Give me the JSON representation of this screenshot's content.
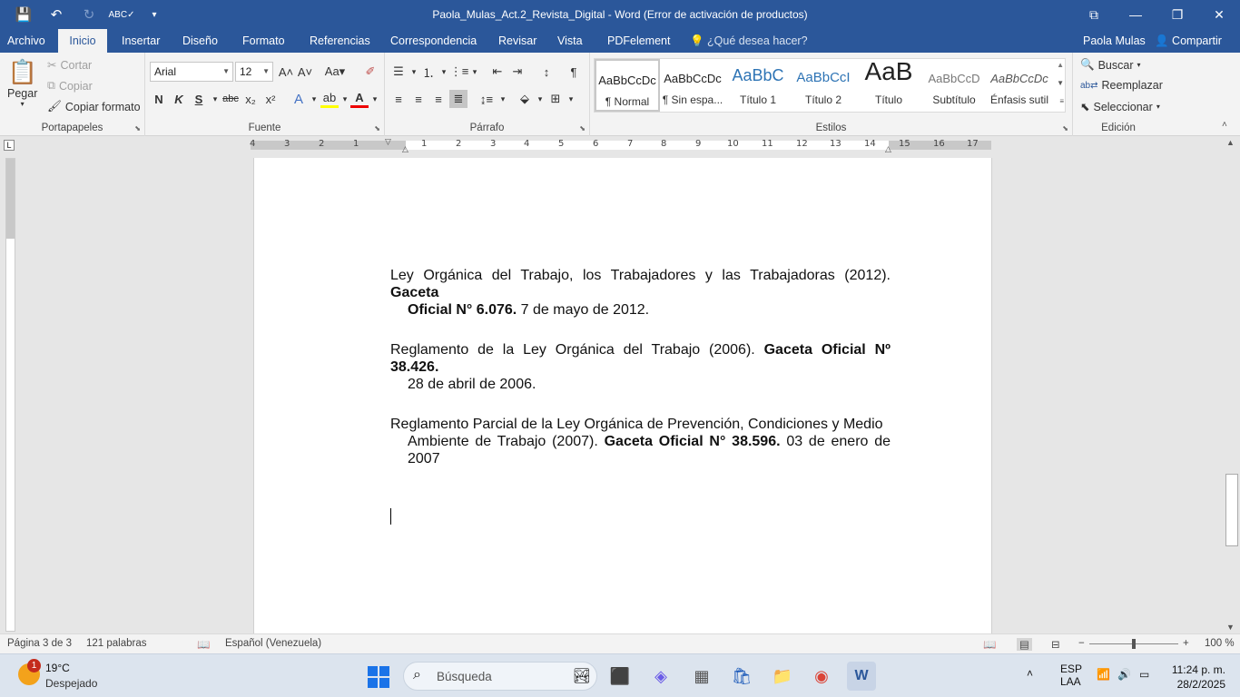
{
  "window": {
    "title": "Paola_Mulas_Act.2_Revista_Digital - Word (Error de activación de productos)",
    "controls": [
      "⧉",
      "—",
      "❐",
      "✕"
    ]
  },
  "qat": {
    "save": "💾",
    "undo": "↶",
    "redo": "↻",
    "spell": "ABC✓",
    "more": "▾"
  },
  "tabs": [
    "Archivo",
    "Inicio",
    "Insertar",
    "Diseño",
    "Formato",
    "Referencias",
    "Correspondencia",
    "Revisar",
    "Vista",
    "PDFelement"
  ],
  "active_tab": "Inicio",
  "tell_me": "¿Qué desea hacer?",
  "user_name": "Paola Mulas",
  "share": "Compartir",
  "clipboard": {
    "paste": "Pegar",
    "cut": "Cortar",
    "copy": "Copiar",
    "format_painter": "Copiar formato",
    "label": "Portapapeles"
  },
  "font": {
    "family": "Arial",
    "size": "12",
    "label": "Fuente",
    "bold": "N",
    "italic": "K",
    "underline": "S",
    "strike": "abc",
    "subscript": "x₂",
    "superscript": "x²"
  },
  "paragraph": {
    "label": "Párrafo"
  },
  "styles": {
    "label": "Estilos",
    "items": [
      {
        "preview": "AaBbCcDc",
        "name": "¶ Normal"
      },
      {
        "preview": "AaBbCcDc",
        "name": "¶ Sin espa..."
      },
      {
        "preview": "AaBbC",
        "name": "Título 1"
      },
      {
        "preview": "AaBbCcI",
        "name": "Título 2"
      },
      {
        "preview": "AaB",
        "name": "Título"
      },
      {
        "preview": "AaBbCcD",
        "name": "Subtítulo"
      },
      {
        "preview": "AaBbCcDc",
        "name": "Énfasis sutil"
      }
    ]
  },
  "editing": {
    "label": "Edición",
    "find": "Buscar",
    "replace": "Reemplazar",
    "select": "Seleccionar"
  },
  "ruler": {
    "corner": "L",
    "marks": [
      "4",
      "3",
      "2",
      "1",
      "1",
      "2",
      "3",
      "4",
      "5",
      "6",
      "7",
      "8",
      "9",
      "10",
      "11",
      "12",
      "13",
      "14",
      "15",
      "16",
      "17"
    ]
  },
  "document": {
    "paragraphs": [
      {
        "l1_plain": "Ley Orgánica del Trabajo, los Trabajadores y las Trabajadoras (2012). ",
        "l1_bold": "Gaceta",
        "l2_bold": "Oficial N° 6.076.",
        "l2_plain": " 7 de mayo de 2012."
      },
      {
        "l1_plain": "Reglamento de la Ley Orgánica del Trabajo (2006). ",
        "l1_bold": "Gaceta Oficial Nº 38.426.",
        "l2_bold": "",
        "l2_plain": "28 de abril de 2006."
      },
      {
        "l1_plain": "Reglamento Parcial de la Ley Orgánica de Prevención, Condiciones y Medio",
        "l1_bold": "",
        "l2_plain": "Ambiente de Trabajo (2007).  ",
        "l2_bold": "Gaceta Oficial N° 38.596.",
        "l2_tail": " 03 de enero de",
        "l3_plain": "2007"
      }
    ]
  },
  "status": {
    "page": "Página 3 de 3",
    "words": "121 palabras",
    "language": "Español (Venezuela)",
    "zoom": "100 %",
    "zoom_percent": 100
  },
  "taskbar": {
    "temp": "19°C",
    "condition": "Despejado",
    "badge": "1",
    "search": "Búsqueda",
    "lang1": "ESP",
    "lang2": "LAA",
    "time": "11:24 p. m.",
    "date": "28/2/2025"
  }
}
